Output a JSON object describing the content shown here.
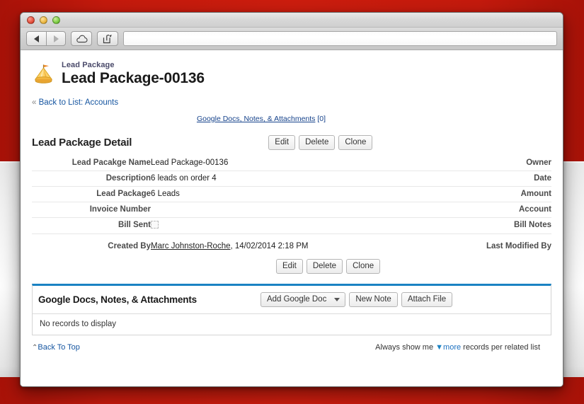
{
  "desktop": {
    "background_color": "#c41a0d",
    "band_color": "#f2f2f2"
  },
  "browser": {
    "window_controls": [
      "close",
      "minimize",
      "zoom"
    ],
    "back_icon": "back-arrow-icon",
    "forward_icon": "forward-arrow-icon",
    "cloud_icon": "icloud-icon",
    "share_icon": "share-icon",
    "address": {
      "value": "",
      "placeholder": ""
    }
  },
  "record": {
    "icon": "lead-package-tent-icon",
    "kind": "Lead Package",
    "title": "Lead Package-00136",
    "back_to_list_prefix": "«",
    "back_to_list_label": "Back to List:",
    "back_to_list_target": "Accounts",
    "top_link_label": "Google Docs, Notes, & Attachments",
    "top_link_count": "[0]"
  },
  "detail": {
    "title": "Lead Package Detail",
    "buttons": [
      "Edit",
      "Delete",
      "Clone"
    ],
    "rows": [
      {
        "label": "Lead Pacakge Name",
        "value": "Lead Package-00136",
        "right_label": "Owner",
        "right_value": ""
      },
      {
        "label": "Description",
        "value": "6 leads on order 4",
        "right_label": "Date",
        "right_value": ""
      },
      {
        "label": "Lead Package",
        "value": "6 Leads",
        "right_label": "Amount",
        "right_value": ""
      },
      {
        "label": "Invoice Number",
        "value": "",
        "right_label": "Account",
        "right_value": ""
      },
      {
        "label": "Bill Sent",
        "value": "",
        "right_label": "Bill Notes",
        "right_value": "",
        "checkbox": true,
        "checked": false
      }
    ],
    "system": {
      "label": "Created By",
      "user": "Marc Johnston-Roche",
      "timestamp": ", 14/02/2014 2:18 PM",
      "right_label": "Last Modified By",
      "right_value": ""
    },
    "footer_buttons": [
      "Edit",
      "Delete",
      "Clone"
    ]
  },
  "related_list": {
    "title": "Google Docs, Notes, & Attachments",
    "dropdown_label": "Add Google Doc",
    "buttons": [
      "New Note",
      "Attach File"
    ],
    "empty_text": "No records to display",
    "accent_color": "#1a82c3"
  },
  "page_footer": {
    "back_to_top_caret": "⌃",
    "back_to_top": "Back To Top",
    "show_prefix": "Always show me",
    "show_link": "more",
    "show_suffix": "records per related list"
  }
}
